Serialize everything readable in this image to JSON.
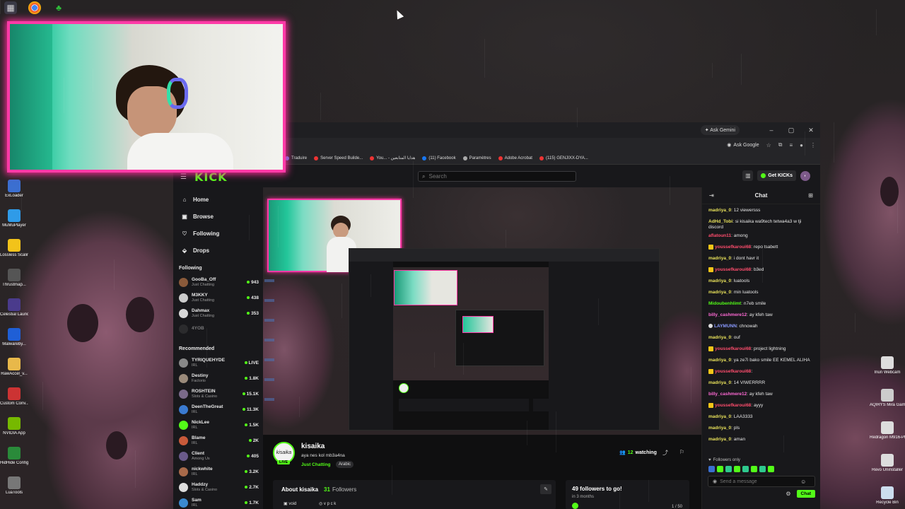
{
  "desktop": {
    "left_icons": [
      {
        "label": "ExLoader",
        "icon": "exloader-icon",
        "color": "#3b6fd0"
      },
      {
        "label": "MuMuPlayer",
        "icon": "mumu-icon",
        "color": "#2f9be8"
      },
      {
        "label": "Lossless Scaling",
        "icon": "lossless-icon",
        "color": "#f2c31a"
      },
      {
        "label": "Thrustmap...",
        "icon": "thrustmap-icon",
        "color": "#555"
      },
      {
        "label": "Celestial Launcher",
        "icon": "celestial-icon",
        "color": "#4a3b8c"
      },
      {
        "label": "Malwareby...",
        "icon": "malwarebytes-icon",
        "color": "#1f5fd6"
      },
      {
        "label": "RawAccel_v...",
        "icon": "folder-icon",
        "color": "#e8b84a"
      },
      {
        "label": "Custom Conv...",
        "icon": "custom-icon",
        "color": "#c33"
      },
      {
        "label": "NVIDIA App",
        "icon": "nvidia-icon",
        "color": "#76b900"
      },
      {
        "label": "HidHide Configurat...",
        "icon": "hidhide-icon",
        "color": "#2a8a3a"
      },
      {
        "label": "LuaTools",
        "icon": "luatools-icon",
        "color": "#777"
      }
    ],
    "right_icons": [
      {
        "label": "Iriun Webcam",
        "icon": "iriun-icon",
        "color": "#ddd"
      },
      {
        "label": "AQIRYS Mira Gaming Ke...",
        "icon": "aqirys-icon",
        "color": "#ccc"
      },
      {
        "label": "Redragon M916-PRO...",
        "icon": "redragon-icon",
        "color": "#ddd"
      },
      {
        "label": "Revo Uninstaller",
        "icon": "revo-icon",
        "color": "#ddd"
      },
      {
        "label": "Recycle Bin",
        "icon": "recycle-bin-icon",
        "color": "#cde"
      }
    ],
    "top_icons": [
      {
        "label": "Display...",
        "icon": "display-icon"
      },
      {
        "label": "Google Chrome",
        "icon": "chrome-icon"
      },
      {
        "label": "Tree",
        "icon": "tree-icon"
      }
    ]
  },
  "browser": {
    "gemini_label": "Ask Gemini",
    "ask_google": "Ask Google",
    "bookmarks": [
      {
        "label": "Traduire",
        "color": "#4285f4"
      },
      {
        "label": "Server Speed Builde...",
        "color": "#e33"
      },
      {
        "label": "You... - هدايا المتابعين",
        "color": "#e33"
      },
      {
        "label": "(11) Facebook",
        "color": "#1877f2"
      },
      {
        "label": "Paramètres",
        "color": "#aaa"
      },
      {
        "label": "Adobe Acrobat",
        "color": "#e33"
      },
      {
        "label": "(115) GENJIXX-DYA...",
        "color": "#e33"
      }
    ]
  },
  "kick": {
    "logo": "KICK",
    "search_placeholder": "Search",
    "get_kicks": "Get KICKs",
    "nav": [
      {
        "label": "Home",
        "icon": "home-icon",
        "glyph": "⌂"
      },
      {
        "label": "Browse",
        "icon": "browse-icon",
        "glyph": "▣"
      },
      {
        "label": "Following",
        "icon": "heart-icon",
        "glyph": "♡"
      },
      {
        "label": "Drops",
        "icon": "drops-icon",
        "glyph": "⬙"
      }
    ],
    "following_title": "Following",
    "following": [
      {
        "name": "GooBa_Off",
        "category": "Just Chatting",
        "viewers": "943",
        "color": "#8a5a3a"
      },
      {
        "name": "M3KKY",
        "category": "Just Chatting",
        "viewers": "438",
        "color": "#ccc"
      },
      {
        "name": "Dahmax",
        "category": "Just Chatting",
        "viewers": "353",
        "color": "#d8d8d8"
      },
      {
        "name": "4YOB",
        "category": "",
        "viewers": "",
        "color": "#444"
      }
    ],
    "recommended_title": "Recommended",
    "recommended": [
      {
        "name": "TYRIQUEHYDE",
        "category": "IRL",
        "viewers": "LIVE",
        "color": "#888"
      },
      {
        "name": "Destiny",
        "category": "Factorio",
        "viewers": "1.8K",
        "color": "#9a8a7a"
      },
      {
        "name": "ROSHTEIN",
        "category": "Slots & Casino",
        "viewers": "15.1K",
        "color": "#7a6a8a"
      },
      {
        "name": "DeenTheGreat",
        "category": "IRL",
        "viewers": "11.3K",
        "color": "#3a7ad0"
      },
      {
        "name": "NickLee",
        "category": "IRL",
        "viewers": "1.5K",
        "color": "#53fc18"
      },
      {
        "name": "Blame",
        "category": "IRL",
        "viewers": "2K",
        "color": "#c85a3a"
      },
      {
        "name": "Client",
        "category": "Among Us",
        "viewers": "405",
        "color": "#6a5a8a"
      },
      {
        "name": "nickwhite",
        "category": "IRL",
        "viewers": "3.2K",
        "color": "#a86a4a"
      },
      {
        "name": "Haddzy",
        "category": "Slots & Casino",
        "viewers": "2.7K",
        "color": "#ddd"
      },
      {
        "name": "Sam",
        "category": "IRL",
        "viewers": "1.7K",
        "color": "#3a8ad0"
      }
    ],
    "stream": {
      "streamer": "kisaika",
      "avatar_text": "kisaika",
      "live": "LIVE",
      "title": "aya nes kol mb3a4na",
      "category": "Just Chatting",
      "tag": "Arabic",
      "watching_count": "12",
      "watching_label": "watching",
      "about_title": "About kisaika",
      "followers_count": "31",
      "followers_label": "Followers",
      "social_1": "void",
      "social_2": "v p c k",
      "goal_title": "49 followers to go!",
      "goal_sub": "in 3 months",
      "goal_count": "1 / 50"
    },
    "chat": {
      "title": "Chat",
      "messages": [
        {
          "user": "madriya_0",
          "color": "#e8e15a",
          "text": "12 viewersss",
          "badge": false
        },
        {
          "user": "AdHd_Tobi",
          "color": "#e8e15a",
          "text": "si kisaika wa9tech tetwa4a3 w tji discord",
          "badge": false
        },
        {
          "user": "aflatoun11",
          "color": "#ff4d6d",
          "text": "among",
          "badge": false
        },
        {
          "user": "youssefkaroui68",
          "color": "#ff4d6d",
          "text": "repo tsabett",
          "badge": true
        },
        {
          "user": "madriya_0",
          "color": "#e8e15a",
          "text": "i dont havr it",
          "badge": false
        },
        {
          "user": "youssefkaroui68",
          "color": "#ff4d6d",
          "text": "b3ed",
          "badge": true
        },
        {
          "user": "madriya_0",
          "color": "#e8e15a",
          "text": "luatools",
          "badge": false
        },
        {
          "user": "madriya_0",
          "color": "#e8e15a",
          "text": "min luatools",
          "badge": false
        },
        {
          "user": "Midoubenhlimt",
          "color": "#53fc18",
          "text": "n7eb smile",
          "badge": false
        },
        {
          "user": "billy_cashmere12",
          "color": "#ff6ad5",
          "text": "ay kfeh taw",
          "badge": false
        },
        {
          "user": "LAYMUNN",
          "color": "#8a9aff",
          "text": "chnowah",
          "badge": false
        },
        {
          "user": "madriya_0",
          "color": "#e8e15a",
          "text": "ouf",
          "badge": false
        },
        {
          "user": "youssefkaroui68",
          "color": "#ff4d6d",
          "text": "project lightning",
          "badge": true
        },
        {
          "user": "madriya_0",
          "color": "#e8e15a",
          "text": "ya ze7i bako smile  EE KEMEL ALIHA",
          "badge": false
        },
        {
          "user": "youssefkaroui68",
          "color": "#ff4d6d",
          "text": "",
          "badge": true
        },
        {
          "user": "madriya_0",
          "color": "#e8e15a",
          "text": "14 VIWERRRR",
          "badge": false
        },
        {
          "user": "billy_cashmere12",
          "color": "#ff6ad5",
          "text": "ay kfeh taw",
          "badge": false
        },
        {
          "user": "youssefkaroui68",
          "color": "#ff4d6d",
          "text": "ayyy",
          "badge": true
        },
        {
          "user": "madriya_0",
          "color": "#e8e15a",
          "text": "LAA3333",
          "badge": false
        },
        {
          "user": "madriya_0",
          "color": "#e8e15a",
          "text": "pls",
          "badge": false
        },
        {
          "user": "madriya_0",
          "color": "#e8e15a",
          "text": "aman",
          "badge": false
        }
      ],
      "followers_only": "Followers only",
      "input_placeholder": "Send a message",
      "send_label": "Chat"
    }
  }
}
